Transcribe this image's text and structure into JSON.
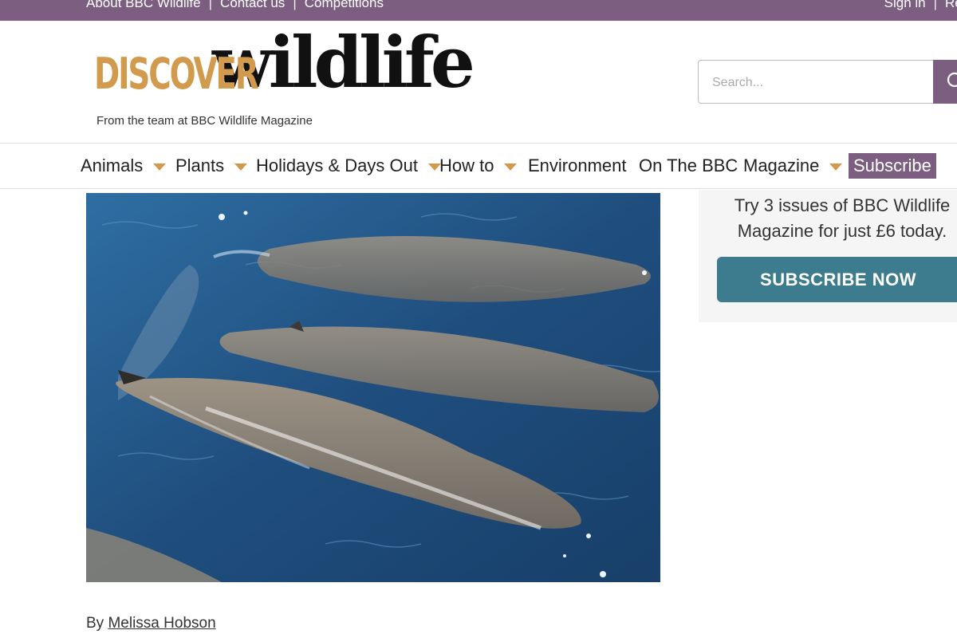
{
  "topbar": {
    "links": [
      "About BBC Wildlife",
      "Contact us",
      "Competitions"
    ],
    "account": [
      "Sign in",
      "Regi"
    ]
  },
  "header": {
    "logo_part1": "DISCOVER",
    "logo_part2": "wildlife",
    "tagline": "From the team at BBC Wildlife Magazine",
    "search": {
      "placeholder": "Search..."
    }
  },
  "nav": {
    "items": [
      {
        "label": "Animals",
        "dropdown": true
      },
      {
        "label": "Plants",
        "dropdown": true
      },
      {
        "label": "Holidays & Days Out",
        "dropdown": true
      },
      {
        "label": "How to",
        "dropdown": true
      },
      {
        "label": "Environment",
        "dropdown": false
      },
      {
        "label": "On The BBC",
        "dropdown": false
      },
      {
        "label": "Magazine",
        "dropdown": true
      }
    ],
    "subscribe_label": "Subscribe"
  },
  "promo": {
    "line1": "Try 3 issues of BBC Wildlife",
    "line2": "Magazine for just £6 today.",
    "button_label": "SUBSCRIBE NOW"
  },
  "byline": {
    "prefix": "By",
    "author": "Melissa Hobson"
  },
  "colors": {
    "brand_purple": "#7c5e80",
    "logo_gold": "#d29a4c",
    "cta_teal": "#3d7b8e",
    "sea_blue": "#1f4e7e"
  },
  "icons": [
    "search-icon",
    "caret-down-icon"
  ]
}
